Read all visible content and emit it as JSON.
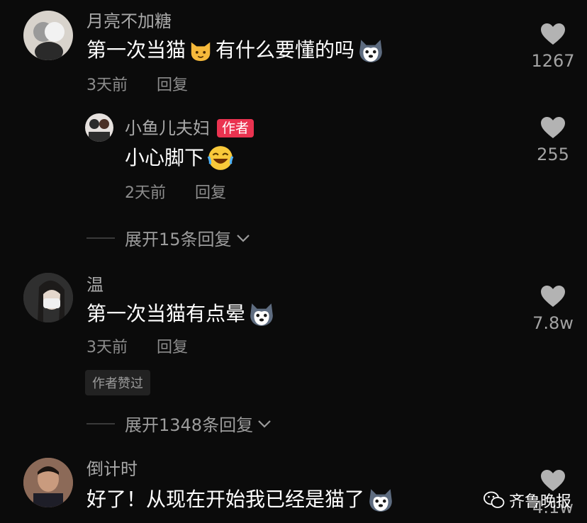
{
  "comments": [
    {
      "name": "月亮不加糖",
      "text_a": "第一次当猫",
      "text_b": "有什么要懂的吗",
      "emoji_a": "cat-emoji",
      "emoji_b": "husky-emoji",
      "time": "3天前",
      "reply_label": "回复",
      "likes": "1267",
      "reply": {
        "name": "小鱼儿夫妇",
        "author_tag": "作者",
        "text": "小心脚下",
        "emoji": "laughing-emoji",
        "time": "2天前",
        "reply_label": "回复",
        "likes": "255"
      },
      "expand": "展开15条回复"
    },
    {
      "name": "温",
      "text": "第一次当猫有点晕",
      "emoji": "husky-emoji",
      "time": "3天前",
      "reply_label": "回复",
      "likes": "7.8w",
      "liked_tag": "作者赞过",
      "expand": "展开1348条回复"
    },
    {
      "name": "倒计时",
      "text": "好了！从现在开始我已经是猫了",
      "emoji": "husky-emoji",
      "likes": "4.1w"
    }
  ],
  "watermark": "齐鲁晚报",
  "colors": {
    "background": "#0b0b0b",
    "author_tag": "#ea3350"
  }
}
